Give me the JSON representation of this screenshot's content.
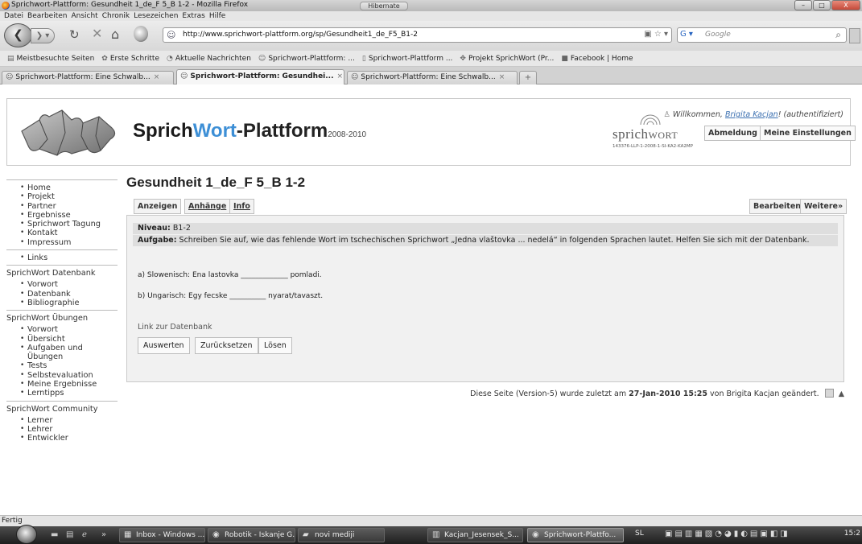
{
  "window": {
    "title": "Sprichwort-Plattform: Gesundheit 1_de_F 5_B 1-2 - Mozilla Firefox",
    "hibernate": "Hibernate",
    "buttons": {
      "minimize": "–",
      "maximize": "□",
      "close": "X"
    }
  },
  "menu": [
    "Datei",
    "Bearbeiten",
    "Ansicht",
    "Chronik",
    "Lesezeichen",
    "Extras",
    "Hilfe"
  ],
  "nav": {
    "url": "http://www.sprichwort-plattform.org/sp/Gesundheit1_de_F5_B1-2",
    "search_placeholder": "Google"
  },
  "bookmarks": [
    {
      "label": "Meistbesuchte Seiten",
      "icon": "page-icon"
    },
    {
      "label": "Erste Schritte",
      "icon": "firefox-icon"
    },
    {
      "label": "Aktuelle Nachrichten",
      "icon": "rss-icon"
    },
    {
      "label": "Sprichwort-Plattform: ...",
      "icon": "site-icon"
    },
    {
      "label": "Sprichwort-Plattform ...",
      "icon": "page-icon"
    },
    {
      "label": "Projekt SprichWort (Pr...",
      "icon": "puzzle-icon"
    },
    {
      "label": "Facebook | Home",
      "icon": "facebook-icon"
    }
  ],
  "tabs": [
    {
      "label": "Sprichwort-Plattform: Eine Schwalb...",
      "active": false
    },
    {
      "label": "Sprichwort-Plattform: Gesundhei...",
      "active": true
    },
    {
      "label": "Sprichwort-Plattform: Eine Schwalb...",
      "active": false
    }
  ],
  "header": {
    "brand_sprich": "Sprich",
    "brand_wort": "Wort",
    "brand_plattform": "-Plattform",
    "brand_years": "2008-2010",
    "welcome_prefix": "Willkommen,",
    "user": "Brigita Kacjan",
    "welcome_suffix": "! (authentifiziert)",
    "logout": "Abmeldung",
    "settings": "Meine Einstellungen",
    "logo_word_a": "sprich",
    "logo_word_b": "WORT",
    "logo_code": "143376-LLP-1-2008-1-SI-KA2-KA2MP"
  },
  "sidebar": {
    "group1": [
      "Home",
      "Projekt",
      "Partner",
      "Ergebnisse",
      "Sprichwort Tagung",
      "Kontakt",
      "Impressum"
    ],
    "group2": [
      "Links"
    ],
    "heading3": "SprichWort Datenbank",
    "group3": [
      "Vorwort",
      "Datenbank",
      "Bibliographie"
    ],
    "heading4": "SprichWort Übungen",
    "group4": [
      "Vorwort",
      "Übersicht",
      "Aufgaben und Übungen",
      "Tests",
      "Selbstevaluation",
      "Meine Ergebnisse",
      "Lerntipps"
    ],
    "heading5": "SprichWort Community",
    "group5": [
      "Lerner",
      "Lehrer",
      "Entwickler"
    ]
  },
  "main": {
    "title": "Gesundheit 1_de_F 5_B 1-2",
    "tabs": {
      "show": "Anzeigen",
      "attachments": "Anhänge",
      "info": "Info",
      "edit": "Bearbeiten",
      "more": "Weitere»"
    },
    "level_label": "Niveau:",
    "level_value": "B1-2",
    "task_label": "Aufgabe:",
    "task_text": "Schreiben Sie auf, wie das fehlende Wort im tschechischen Sprichwort „Jedna vlaštovka ... nedelá“ in folgenden Sprachen lautet. Helfen Sie sich mit der Datenbank.",
    "item_a": "a) Slowenisch: Ena lastovka _____________ pomladi.",
    "item_b": "b) Ungarisch: Egy fecske __________ nyarat/tavaszt.",
    "db_link": "Link zur Datenbank",
    "btn_eval": "Auswerten",
    "btn_reset": "Zurücksetzen",
    "btn_solve": "Lösen",
    "footer_prefix": "Diese Seite (Version-5) wurde zuletzt am",
    "footer_date": "27-Jan-2010 15:25",
    "footer_suffix": "von Brigita Kacjan geändert."
  },
  "status": "Fertig",
  "taskbar": {
    "items": [
      {
        "label": "Inbox - Windows ...",
        "active": false
      },
      {
        "label": "Robotik - Iskanje G...",
        "active": false
      },
      {
        "label": "novi mediji",
        "active": false
      },
      {
        "label": "Kacjan_Jesensek_S...",
        "active": false
      },
      {
        "label": "Sprichwort-Plattfo...",
        "active": true
      }
    ],
    "lang": "SL",
    "clock": "15:2"
  }
}
